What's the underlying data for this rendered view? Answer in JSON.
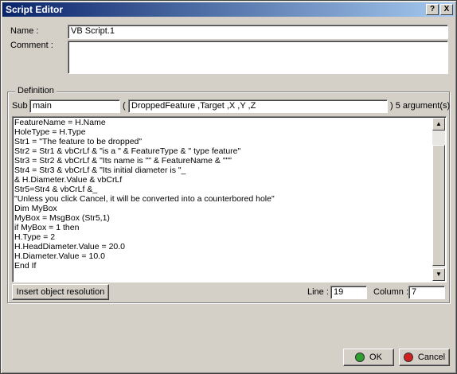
{
  "window": {
    "title": "Script Editor",
    "help_label": "?",
    "close_label": "X"
  },
  "name_label": "Name :",
  "name_value": "VB Script.1",
  "comment_label": "Comment :",
  "comment_value": "",
  "definition_label": "Definition",
  "sub_label": "Sub",
  "sub_name": "main",
  "open_paren": "(",
  "args_value": "DroppedFeature ,Target ,X ,Y ,Z",
  "args_count": ") 5 argument(s)",
  "code": [
    "FeatureName = H.Name",
    "HoleType = H.Type",
    "Str1 = \"The feature to be dropped\"",
    "Str2 = Str1 & vbCrLf & \"is a \" & FeatureType & \" type feature\"",
    "Str3 = Str2 & vbCrLf & \"Its name is \"\" & FeatureName & \"\"\"",
    "Str4 = Str3 & vbCrLf & \"Its initial diameter is \"_",
    "& H.Diameter.Value & vbCrLf",
    "Str5=Str4 & vbCrLf &_",
    "\"Unless you click Cancel, it will be converted into a counterbored hole\"",
    "Dim MyBox",
    "MyBox = MsgBox (Str5,1)",
    "if MyBox = 1 then",
    "H.Type = 2",
    "H.HeadDiameter.Value = 20.0",
    "H.Diameter.Value = 10.0",
    "End If"
  ],
  "insert_button_label": "Insert object resolution",
  "line_label": "Line :",
  "line_value": "19",
  "column_label": "Column :",
  "column_value": "7",
  "ok_label": "OK",
  "cancel_label": "Cancel",
  "colors": {
    "ok_icon": "#2ea02e",
    "cancel_icon": "#d02020",
    "titlebar": "#0a246a"
  },
  "icons": {
    "scroll_up": "▲",
    "scroll_down": "▼"
  }
}
